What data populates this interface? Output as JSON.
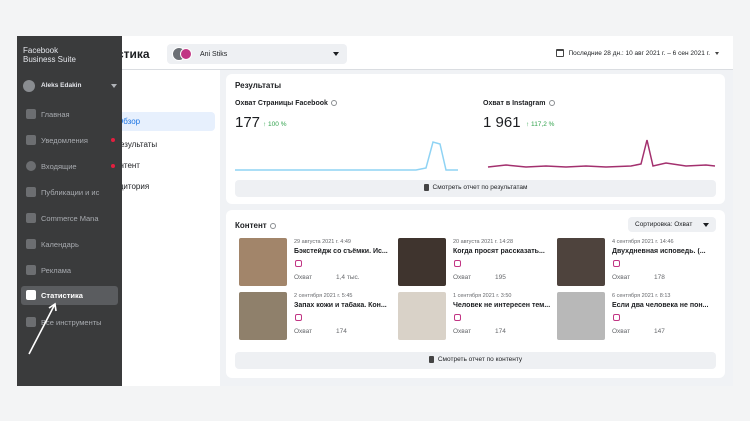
{
  "brand": {
    "line1": "Facebook",
    "line2": "Business Suite"
  },
  "user": {
    "name": "Aleks Edakin"
  },
  "sidebar": {
    "items": [
      {
        "label": "Главная",
        "icon": "home-icon",
        "dot": false
      },
      {
        "label": "Уведомления",
        "icon": "bell-icon",
        "dot": true
      },
      {
        "label": "Входящие",
        "icon": "chat-icon",
        "dot": true
      },
      {
        "label": "Публикации и ис",
        "icon": "posts-icon",
        "dot": false
      },
      {
        "label": "Commerce Mana",
        "icon": "cart-icon",
        "dot": false
      },
      {
        "label": "Календарь",
        "icon": "calendar-icon",
        "dot": false
      },
      {
        "label": "Реклама",
        "icon": "megaphone-icon",
        "dot": false
      },
      {
        "label": "Статистика",
        "icon": "chart-icon",
        "active": true
      },
      {
        "label": "Все инструменты",
        "icon": "menu-icon",
        "dot": false
      }
    ]
  },
  "header": {
    "title": "стика",
    "account": "Ani Stiks",
    "date_range": "Последние 28 дн.: 10 авг 2021 г. – 6 сен 2021 г."
  },
  "subnav": {
    "items": [
      "Обзор",
      "Результаты",
      "онтент",
      "удитория"
    ]
  },
  "results": {
    "title": "Результаты",
    "facebook": {
      "title": "Охват Страницы Facebook",
      "value": "177",
      "change": "↑ 100 %"
    },
    "instagram": {
      "title": "Охват в Instagram",
      "value": "1 961",
      "change": "↑ 117,2 %"
    },
    "button": "Смотреть отчет по результатам"
  },
  "content": {
    "title": "Контент",
    "sort": "Сортировка: Охват",
    "button": "Смотреть отчет по контенту",
    "posts": [
      {
        "date": "29 августа 2021 г. 4:49",
        "text": "Бэкстейдж со съёмки. Ис...",
        "metric": "Охват",
        "value": "1,4 тыс."
      },
      {
        "date": "20 августа 2021 г. 14:28",
        "text": "Когда просят рассказать...",
        "metric": "Охват",
        "value": "195"
      },
      {
        "date": "4 сентября 2021 г. 14:46",
        "text": "Двухдневная исповедь. (...",
        "metric": "Охват",
        "value": "178"
      },
      {
        "date": "2 сентября 2021 г. 5:45",
        "text": "Запах кожи и табака. Кон...",
        "metric": "Охват",
        "value": "174"
      },
      {
        "date": "1 сентября 2021 г. 3:50",
        "text": "Человек не интересен тем...",
        "metric": "Охват",
        "value": "174"
      },
      {
        "date": "6 сентября 2021 г. 8:13",
        "text": "Если два человека не пон...",
        "metric": "Охват",
        "value": "147"
      }
    ]
  },
  "colors": {
    "accent": "#1b74e4",
    "facebook_line": "#8fd3f4",
    "instagram_line": "#a3306e",
    "positive": "#31a24c"
  }
}
